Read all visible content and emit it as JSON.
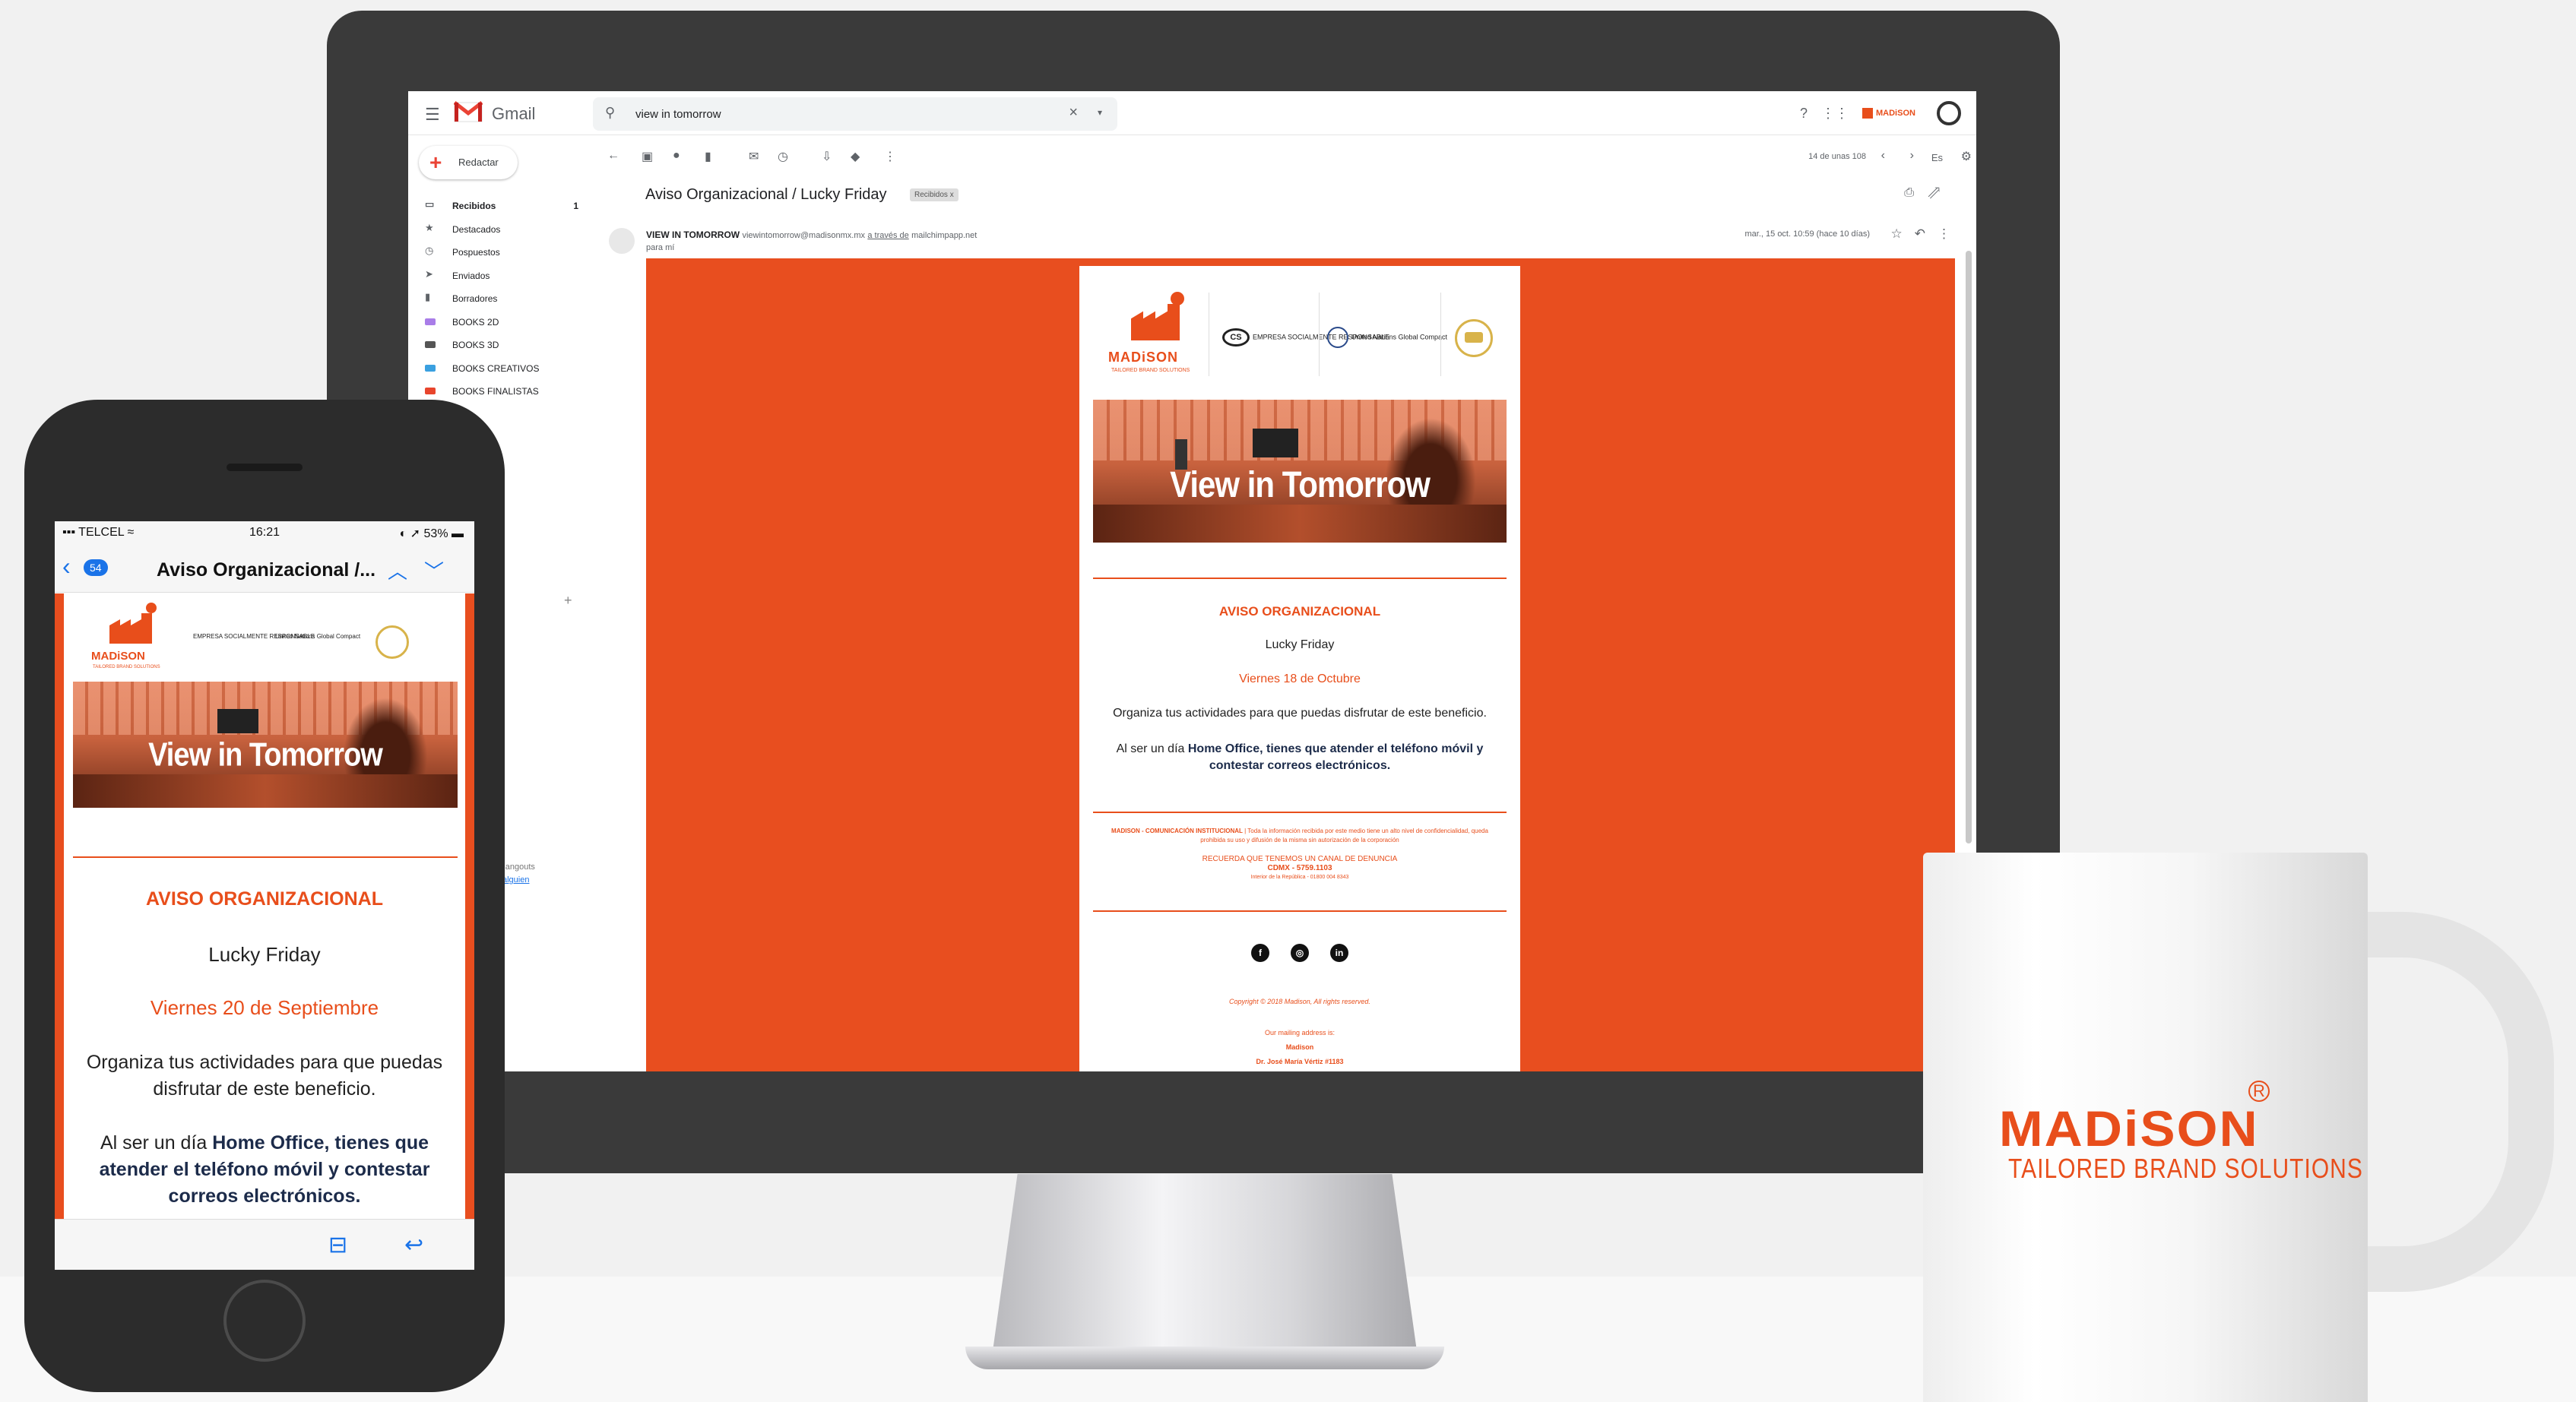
{
  "colors": {
    "brand_orange": "#e84e1b",
    "email_bg": "#e84e1f",
    "link_blue": "#1a73e8"
  },
  "gmail": {
    "app_name": "Gmail",
    "search_query": "view in tomorrow",
    "compose_label": "Redactar",
    "sidebar": [
      {
        "label": "Recibidos",
        "count": "1",
        "icon": "inbox-icon",
        "active": true
      },
      {
        "label": "Destacados",
        "icon": "star-icon"
      },
      {
        "label": "Pospuestos",
        "icon": "clock-icon"
      },
      {
        "label": "Enviados",
        "icon": "send-icon"
      },
      {
        "label": "Borradores",
        "icon": "draft-icon"
      },
      {
        "label": "BOOKS 2D",
        "tag_color": "#a97de8"
      },
      {
        "label": "BOOKS 3D",
        "tag_color": "#555555"
      },
      {
        "label": "BOOKS CREATIVOS",
        "tag_color": "#3aa0e0"
      },
      {
        "label": "BOOKS FINALISTAS",
        "tag_color": "#e8452c"
      }
    ],
    "hangouts_text": "s de Hangouts",
    "hangouts_link": "alguien",
    "pagination": "14 de unas 108",
    "language": "Es",
    "subject": "Aviso Organizacional / Lucky Friday",
    "label_chip": "Recibidos x",
    "sender_name": "VIEW IN TOMORROW",
    "sender_address": "viewintomorrow@madisonmx.mx",
    "via_label": "a través de",
    "via_domain": "mailchimpapp.net",
    "to_line": "para mí",
    "date": "mar., 15 oct. 10:59 (hace 10 días)"
  },
  "email": {
    "brand": "MADiSON",
    "brand_sub": "TAILORED BRAND SOLUTIONS",
    "partner_esr": "EMPRESA SOCIALMENTE RESPONSABLE",
    "partner_un": "United Nations Global Compact",
    "banner_text": "View in Tomorrow",
    "heading": "AVISO ORGANIZACIONAL",
    "lucky": "Lucky Friday",
    "date": "Viernes 18 de Octubre",
    "organiza": "Organiza tus actividades para que puedas disfrutar de este beneficio.",
    "home_prefix": "Al ser un día ",
    "home_bold": "Home Office, tienes que atender el teléfono móvil y contestar correos electrónicos.",
    "fine_bold": "MADISON - COMUNICACIÓN INSTITUCIONAL",
    "fine_text": " | Toda la información recibida por este medio tiene un alto nivel de confidencialidad, queda prohibida su uso y difusión de la misma sin autorización de la corporación",
    "denuncia": "RECUERDA QUE TENEMOS UN CANAL DE DENUNCIA",
    "cdmx": "CDMX - 5759.1103",
    "interior": "Interior de la República - 01800 004 8343",
    "copyright": "Copyright © 2018 Madison, All rights reserved.",
    "mailing": "Our mailing address is:",
    "mailing_name": "Madison",
    "mailing_street": "Dr. José María Vértiz #1183"
  },
  "phone": {
    "carrier": "TELCEL",
    "time": "16:21",
    "battery": "53%",
    "back_count": "54",
    "title": "Aviso Organizacional /...",
    "heading": "AVISO ORGANIZACIONAL",
    "lucky": "Lucky Friday",
    "date": "Viernes 20 de Septiembre",
    "organiza": "Organiza tus actividades para que puedas disfrutar de este beneficio.",
    "home_prefix": "Al ser un día ",
    "home_bold": "Home Office, tienes que atender el teléfono móvil y contestar correos electrónicos."
  },
  "mug": {
    "brand": "MADiSON",
    "tagline": "TAILORED BRAND SOLUTIONS",
    "registered": "R"
  }
}
